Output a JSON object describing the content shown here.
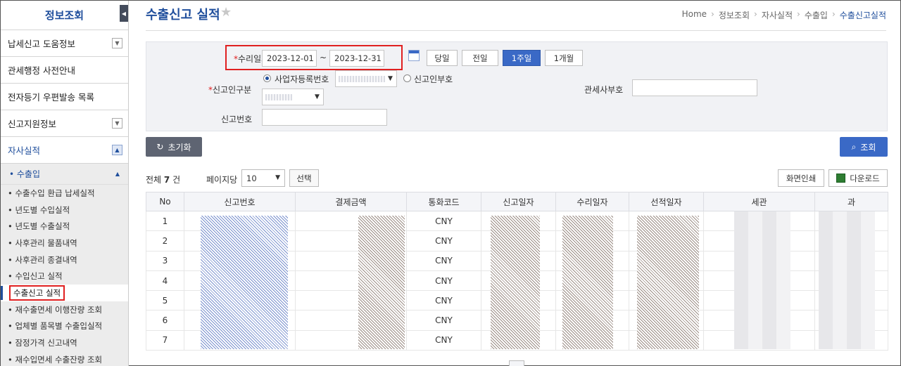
{
  "sidebar": {
    "title": "정보조회",
    "items": [
      {
        "label": "납세신고 도움정보",
        "expander": "down"
      },
      {
        "label": "관세행정 사전안내",
        "expander": ""
      },
      {
        "label": "전자등기 우편발송 목록",
        "expander": ""
      },
      {
        "label": "신고지원정보",
        "expander": "down"
      },
      {
        "label": "자사실적",
        "expander": "up"
      }
    ],
    "group": "• 수출입",
    "subitems": [
      "• 수출수입 환급 납세실적",
      "• 년도별 수입실적",
      "• 년도별 수출실적",
      "• 사후관리 물품내역",
      "• 사후관리 종결내역",
      "• 수입신고 실적",
      "수출신고 실적",
      "• 재수출면세 이행잔량 조회",
      "• 업체별 품목별 수출입실적",
      "• 잠정가격 신고내역",
      "• 재수입면세 수출잔량 조회"
    ]
  },
  "header": {
    "title": "수출신고 실적",
    "breadcrumb": [
      "Home",
      "정보조회",
      "자사실적",
      "수출입",
      "수출신고실적"
    ]
  },
  "search": {
    "date_label": "수리일자",
    "date_from": "2023-12-01",
    "date_sep": "~",
    "date_to": "2023-12-31",
    "periods": [
      "당일",
      "전일",
      "1주일",
      "1개월"
    ],
    "selected_period": "1주일",
    "declarant_label": "신고인구분",
    "radio_biz": "사업자등록번호",
    "radio_declarant": "신고인부호",
    "broker_label": "관세사부호",
    "decl_no_label": "신고번호"
  },
  "buttons": {
    "reset": "초기화",
    "search": "조회",
    "print": "화면인쇄",
    "download": "다운로드",
    "select": "선택"
  },
  "list": {
    "total_prefix": "전체",
    "total_count": "7",
    "total_suffix": "건",
    "per_page_label": "페이지당",
    "per_page_value": "10"
  },
  "table": {
    "headers": [
      "No",
      "신고번호",
      "결제금액",
      "통화코드",
      "신고일자",
      "수리일자",
      "선적일자",
      "세관",
      "과"
    ],
    "rows": [
      {
        "no": "1",
        "currency": "CNY"
      },
      {
        "no": "2",
        "currency": "CNY"
      },
      {
        "no": "3",
        "currency": "CNY"
      },
      {
        "no": "4",
        "currency": "CNY"
      },
      {
        "no": "5",
        "currency": "CNY"
      },
      {
        "no": "6",
        "currency": "CNY"
      },
      {
        "no": "7",
        "currency": "CNY"
      }
    ]
  }
}
